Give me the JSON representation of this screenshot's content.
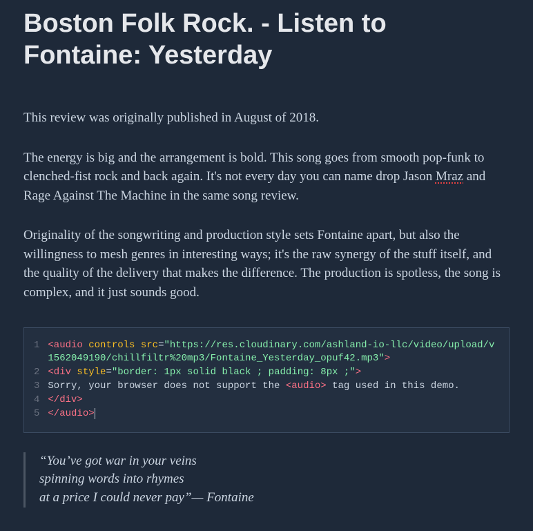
{
  "title": "Boston Folk Rock. - Listen to Fontaine: Yesterday",
  "paragraphs": {
    "p1": "This review was originally published in August of 2018.",
    "p2a": "The energy is big and the arrangement is bold. This song goes from smooth pop-funk to clenched-fist rock and back again. It's not every day you can name drop Jason ",
    "p2_mraz": "Mraz",
    "p2b": " and Rage Against The Machine in the same song review.",
    "p3": "Originality of the songwriting and production style sets Fontaine apart, but also the willingness to mesh genres in interesting ways; it's the raw synergy of the stuff itself, and the quality of the delivery that makes the difference. The production is spotless, the song is complex, and it just sounds good."
  },
  "code": {
    "ln1": "1",
    "ln2": "2",
    "ln3": "3",
    "ln4": "4",
    "ln5": "5",
    "l1_tag_open": "<audio",
    "l1_sp1": " ",
    "l1_attr1": "controls",
    "l1_sp2": " ",
    "l1_attr2": "src",
    "l1_eq": "=",
    "l1_str": "\"https://res.cloudinary.com/ashland-io-llc/video/upload/v1562049190/chillfiltr%20mp3/Fontaine_Yesterday_opuf42.mp3\"",
    "l1_close": ">",
    "l2_tag_open": "<div",
    "l2_sp": " ",
    "l2_attr": "style",
    "l2_eq": "=",
    "l2_str": "\"border: 1px solid black ; padding: 8px ;\"",
    "l2_close": ">",
    "l3_a": "Sorry, your browser does not support the ",
    "l3_tag": "<audio>",
    "l3_b": " tag used in this demo.",
    "l4": "</div>",
    "l5": "</audio>"
  },
  "quote": {
    "line1": "“You’ve got war in your veins",
    "line2": "spinning words into rhymes",
    "line3": "at a price I could never pay”— Fontaine"
  }
}
